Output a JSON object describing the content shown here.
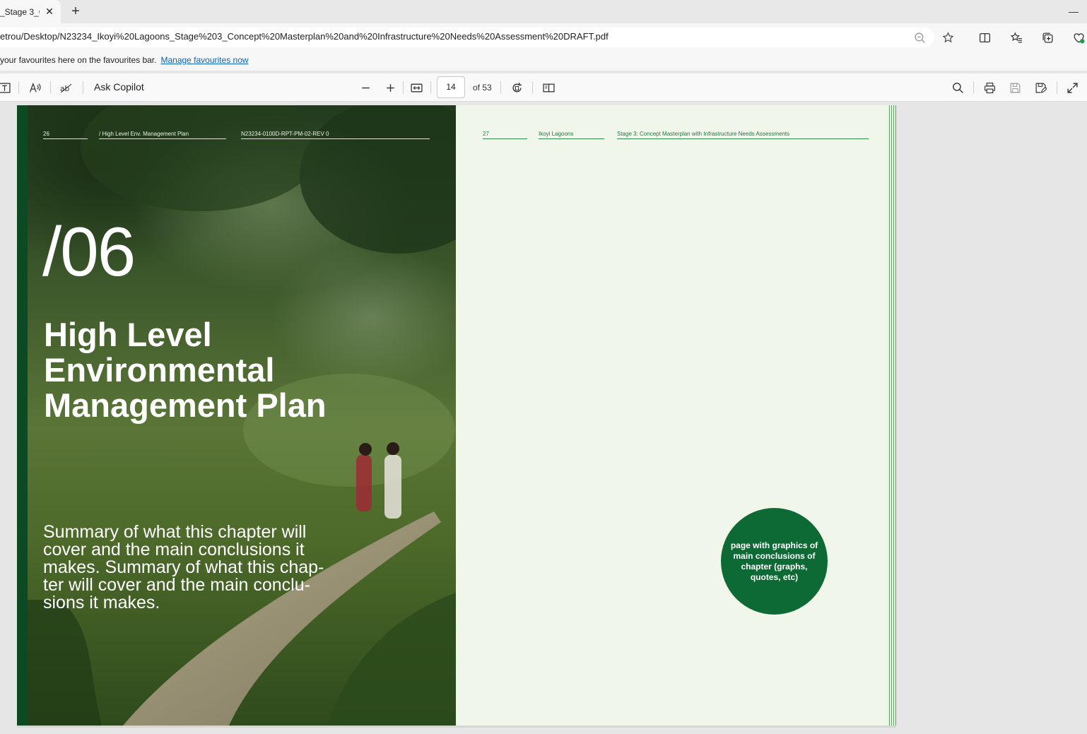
{
  "tab": {
    "title": "_Stage 3_C",
    "close_glyph": "✕"
  },
  "newtab_glyph": "+",
  "window": {
    "minimize_glyph": "—"
  },
  "address": {
    "url": "etrou/Desktop/N23234_Ikoyi%20Lagoons_Stage%203_Concept%20Masterplan%20and%20Infrastructure%20Needs%20Assessment%20DRAFT.pdf"
  },
  "favbar": {
    "text": "your favourites here on the favourites bar.",
    "link": "Manage favourites now"
  },
  "pdf_toolbar": {
    "ask_copilot": "Ask Copilot",
    "page_current": "14",
    "page_of": "of 53"
  },
  "left_page": {
    "page_number": "26",
    "section": "/ High Level Env. Management Plan",
    "doc_ref": "N23234-0100D-RPT-PM-02-REV 0",
    "chapter_number": "/06",
    "title": "High Level Environmental Management Plan",
    "summary": "Summary of what this chapter will cover and the main conclusions it makes. Summary of what this chap-ter will cover and the main conclu-sions it makes."
  },
  "right_page": {
    "page_number": "27",
    "project": "Ikoyi Lagoons",
    "stage": "Stage 3: Concept Masterplan with Infrastructure Needs Assessments",
    "circle_text": "page with graphics of main conclusions of chapter (graphs, quotes, etc)"
  }
}
